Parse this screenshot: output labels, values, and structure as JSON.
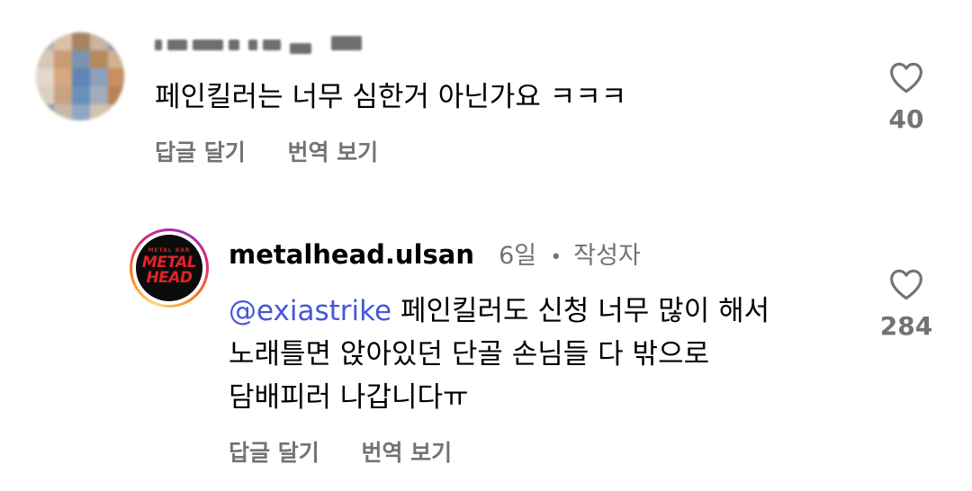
{
  "comment1": {
    "text": "페인킬러는 너무 심한거 아닌가요 ㅋㅋㅋ",
    "actions": {
      "reply": "답글 달기",
      "translate": "번역 보기"
    },
    "like_count": "40"
  },
  "reply": {
    "username": "metalhead.ulsan",
    "time": "6일",
    "separator": "•",
    "author_badge": "작성자",
    "avatar_text": {
      "small": "METAL BAR",
      "line1": "METAL",
      "line2": "HEAD"
    },
    "mention": "@exiastrike",
    "line1": "페인킬러도 신청 너무 많이 해서",
    "line2": "노래틀면 앉아있던 단골 손님들 다 밖으로",
    "line3": "담배피러 나갑니다ㅠ",
    "actions": {
      "reply": "답글 달기",
      "translate": "번역 보기"
    },
    "like_count": "284"
  },
  "colors": {
    "secondary_text": "#737373",
    "mention": "#4656d8",
    "logo_red": "#e12326"
  }
}
